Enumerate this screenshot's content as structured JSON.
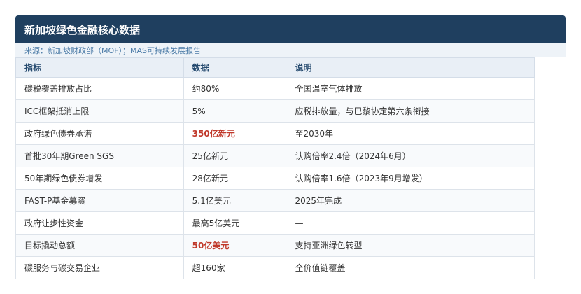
{
  "title": "新加坡绿色金融核心数据",
  "source": "来源：新加坡财政部（MOF）；MAS可持续发展报告",
  "headers": [
    "指标",
    "数据",
    "说明"
  ],
  "rows": [
    {
      "indicator": "碳税覆盖排放占比",
      "value": "约80%",
      "note": "全国温室气体排放",
      "highlight": false
    },
    {
      "indicator": "ICC框架抵消上限",
      "value": "5%",
      "note": "应税排放量，与巴黎协定第六条衔接",
      "highlight": false
    },
    {
      "indicator": "政府绿色债券承诺",
      "value": "350亿新元",
      "note": "至2030年",
      "highlight": true
    },
    {
      "indicator": "首批30年期Green SGS",
      "value": "25亿新元",
      "note": "认购倍率2.4倍（2024年6月）",
      "highlight": false
    },
    {
      "indicator": "50年期绿色债券增发",
      "value": "28亿新元",
      "note": "认购倍率1.6倍（2023年9月增发）",
      "highlight": false
    },
    {
      "indicator": "FAST-P基金募资",
      "value": "5.1亿美元",
      "note": "2025年完成",
      "highlight": false
    },
    {
      "indicator": "政府让步性资金",
      "value": "最高5亿美元",
      "note": "—",
      "highlight": false
    },
    {
      "indicator": "目标撬动总额",
      "value": "50亿美元",
      "note": "支持亚洲绿色转型",
      "highlight": true
    },
    {
      "indicator": "碳服务与碳交易企业",
      "value": "超160家",
      "note": "全价值链覆盖",
      "highlight": false
    }
  ],
  "colors": {
    "header_bg": "#1f3f5f",
    "highlight": "#c0392b"
  }
}
